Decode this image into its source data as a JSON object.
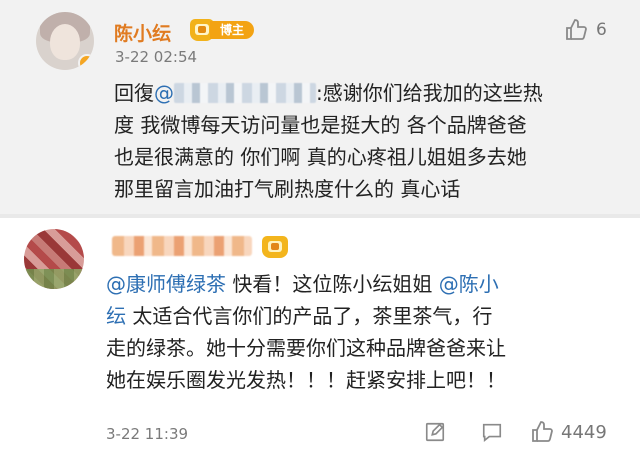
{
  "comments": [
    {
      "author": "陈小纭",
      "badge": "博主",
      "time": "3-22 02:54",
      "likes": "6",
      "lines": [
        {
          "prefix": "回復",
          "mention": "@",
          "suffix": ":感谢你们给我加的这些热"
        },
        {
          "text": "度 我微博每天访问量也是挺大的 各个品牌爸爸"
        },
        {
          "text": "也是很满意的 你们啊 真的心疼祖儿姐姐多去她"
        },
        {
          "text": "那里留言加油打气刷热度什么的 真心话"
        }
      ]
    },
    {
      "time": "3-22 11:39",
      "likes": "4449",
      "lines": [
        {
          "mention1": "@康师傅绿茶",
          "mid": " 快看！这位陈小纭姐姐 ",
          "mention2": "@陈小"
        },
        {
          "mention": "纭",
          "suffix": " 太适合代言你们的产品了，茶里茶气，行"
        },
        {
          "text": "走的绿茶。她十分需要你们这种品牌爸爸来让"
        },
        {
          "text": "她在娱乐圈发光发热！！！赶紧安排上吧！！"
        }
      ]
    }
  ],
  "colors": {
    "name": "#e07b21",
    "mention": "#2d6fb3",
    "badge": "#f3a313",
    "icon": "#8a8a8a"
  },
  "icons": [
    "thumbs-up-icon",
    "edit-icon",
    "comment-icon",
    "crown-badge-icon"
  ]
}
